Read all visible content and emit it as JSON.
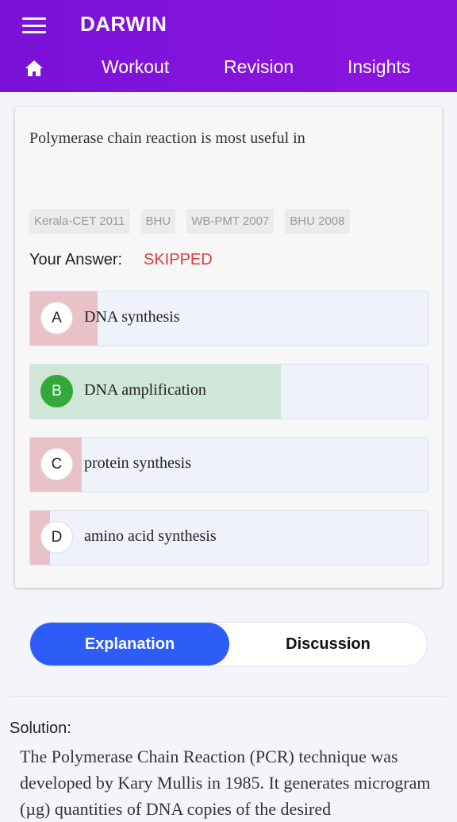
{
  "header": {
    "app_title": "DARWIN",
    "nav": [
      "Workout",
      "Revision",
      "Insights"
    ]
  },
  "question": {
    "text": "Polymerase chain reaction is most useful in",
    "tags": [
      "Kerala-CET 2011",
      "BHU",
      "WB-PMT 2007",
      "BHU 2008"
    ],
    "answer_label": "Your Answer:",
    "answer_status": "SKIPPED"
  },
  "options": [
    {
      "letter": "A",
      "text": "DNA synthesis",
      "response_fraction": 0.17,
      "correct": false
    },
    {
      "letter": "B",
      "text": "DNA amplification",
      "response_fraction": 0.63,
      "correct": true
    },
    {
      "letter": "C",
      "text": "protein synthesis",
      "response_fraction": 0.13,
      "correct": false
    },
    {
      "letter": "D",
      "text": "amino acid synthesis",
      "response_fraction": 0.05,
      "correct": false
    }
  ],
  "tabs": {
    "explanation": "Explanation",
    "discussion": "Discussion"
  },
  "solution": {
    "label": "Solution:",
    "text": "The Polymerase Chain Reaction (PCR) technique was developed by Kary Mullis in 1985. It generates microgram (µg) quantities of DNA copies of the desired"
  },
  "colors": {
    "header": "#7a12d8",
    "wrong_fill": "#e8c2c8",
    "correct_fill": "#cfe6d8",
    "correct_badge": "#33a93c",
    "tab_active": "#2d5cf6",
    "skipped": "#e0393e"
  }
}
